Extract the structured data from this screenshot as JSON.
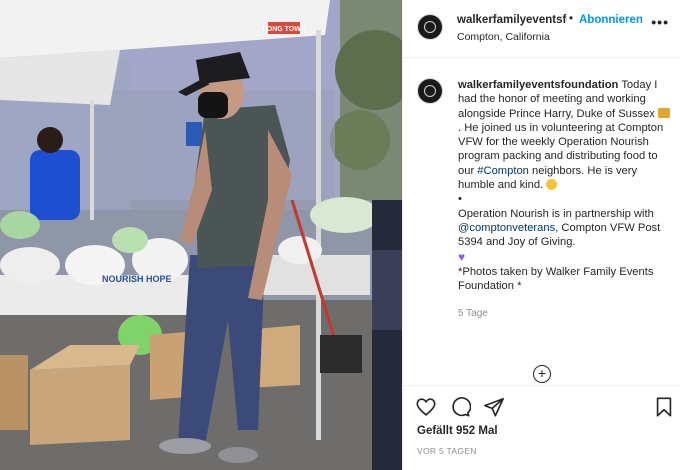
{
  "post": {
    "header": {
      "username": "walkerfamilyeventsfc",
      "separator": "•",
      "follow_label": "Abonnieren",
      "location": "Compton, California",
      "more_icon": "more-horizontal-icon"
    },
    "caption": {
      "username": "walkerfamilyeventsfoundation",
      "text_1": "Today I had the honor of meeting and working alongside Prince Harry, Duke of Sussex",
      "text_2": ". He joined us in volunteering at Compton VFW for the weekly Operation Nourish program packing and distributing food to our",
      "hashtag": "#Compton",
      "text_3": "neighbors. He is very humble and kind.",
      "bullet": "•",
      "text_4": "Operation Nourish is in partnership with",
      "mention": "@comptonveterans",
      "text_5": ", Compton VFW Post 5394 and Joy of Giving.",
      "text_6": "*Photos taken by Walker Family Events Foundation *",
      "time": "5 Tage"
    },
    "load_more_label": "+",
    "actions": {
      "like_icon": "heart-icon",
      "comment_icon": "comment-icon",
      "share_icon": "share-icon",
      "save_icon": "bookmark-icon"
    },
    "likes": "Gefällt 952 Mal",
    "date": "VOR 5 TAGEN"
  },
  "photo": {
    "tent_sign": "LONG TOWE",
    "bag_text": "NOURISH HOPE"
  }
}
